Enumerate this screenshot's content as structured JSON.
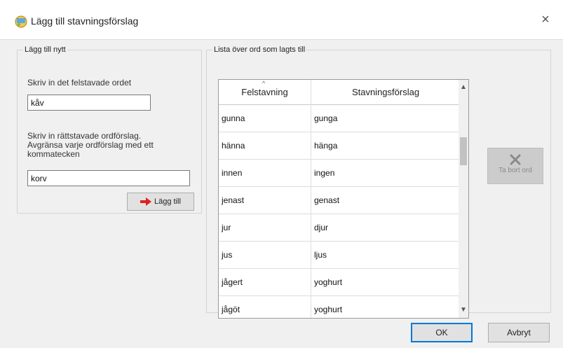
{
  "window": {
    "title": "Lägg till stavningsförslag",
    "close_glyph": "×"
  },
  "left_group": {
    "legend": "Lägg till nytt",
    "misspelled_label": "Skriv in det felstavade ordet",
    "misspelled_value": "kåv",
    "suggestions_label_line1": "Skriv in rättstavade ordförslag.",
    "suggestions_label_line2": "Avgränsa varje ordförslag med ett",
    "suggestions_label_line3": "kommatecken",
    "suggestions_value": "korv",
    "add_button_label": "Lägg till"
  },
  "right_group": {
    "legend": "Lista över ord som lagts till",
    "columns": [
      "Felstavning",
      "Stavningsförslag"
    ],
    "rows": [
      [
        "gunna",
        "gunga"
      ],
      [
        "hänna",
        "hänga"
      ],
      [
        "innen",
        "ingen"
      ],
      [
        "jenast",
        "genast"
      ],
      [
        "jur",
        "djur"
      ],
      [
        "jus",
        "ljus"
      ],
      [
        "jågert",
        "yoghurt"
      ],
      [
        "jågöt",
        "yoghurt"
      ]
    ],
    "remove_button_label": "Ta bort ord"
  },
  "footer": {
    "ok_label": "OK",
    "cancel_label": "Avbryt"
  },
  "colors": {
    "accent": "#0078d7",
    "arrow": "#e02020"
  }
}
